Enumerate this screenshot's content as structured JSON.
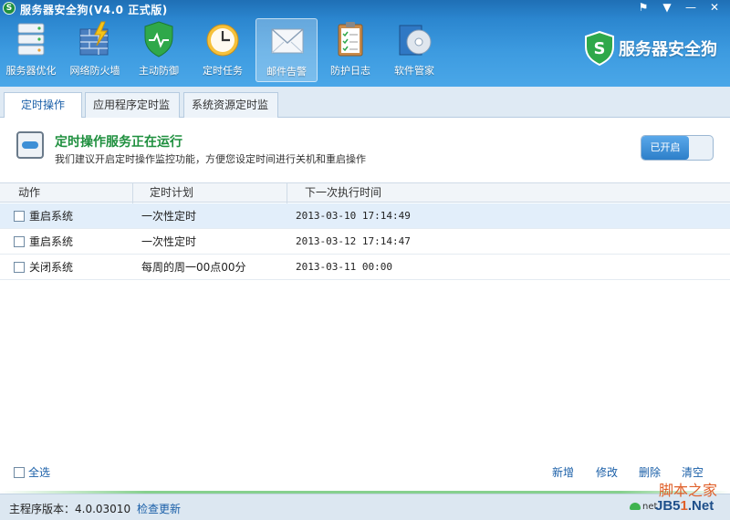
{
  "window": {
    "title": "服务器安全狗(V4.0 正式版)",
    "logo_letter": "S",
    "buttons": [
      "⚑",
      "▼",
      "—",
      "✕"
    ]
  },
  "toolbar": {
    "items": [
      {
        "label": "服务器优化",
        "icon": "server-rack-icon"
      },
      {
        "label": "网络防火墙",
        "icon": "firewall-bolt-icon"
      },
      {
        "label": "主动防御",
        "icon": "shield-icon"
      },
      {
        "label": "定时任务",
        "icon": "clock-icon"
      },
      {
        "label": "邮件告警",
        "icon": "mail-icon"
      },
      {
        "label": "防护日志",
        "icon": "clipboard-icon"
      },
      {
        "label": "软件管家",
        "icon": "disc-box-icon"
      }
    ],
    "active_index": 4
  },
  "brand": {
    "text": "服务器安全狗",
    "badge_letter": "S"
  },
  "tabs": [
    {
      "label": "定时操作",
      "active": true
    },
    {
      "label": "应用程序定时监控",
      "active": false
    },
    {
      "label": "系统资源定时监控",
      "active": false
    }
  ],
  "status": {
    "title": "定时操作服务正在运行",
    "description": "我们建议开启定时操作监控功能，方便您设定时间进行关机和重启操作",
    "toggle_label": "已开启"
  },
  "table": {
    "columns": [
      "动作",
      "定时计划",
      "下一次执行时间"
    ],
    "rows": [
      {
        "action": "重启系统",
        "plan": "一次性定时",
        "next": "2013-03-10 17:14:49",
        "selected": true
      },
      {
        "action": "重启系统",
        "plan": "一次性定时",
        "next": "2013-03-12 17:14:47",
        "selected": false
      },
      {
        "action": "关闭系统",
        "plan": "每周的周一00点00分",
        "next": "2013-03-11 00:00",
        "selected": false
      }
    ]
  },
  "footer": {
    "select_all": "全选",
    "actions": [
      "新增",
      "修改",
      "删除",
      "清空"
    ]
  },
  "statusbar": {
    "version": "主程序版本：4.0.03010",
    "check_update": "检查更新",
    "net_label": "net"
  },
  "watermark": {
    "cn": "脚本之家",
    "en_prefix": "JB5",
    "en_num": "1",
    "en_suffix": ".Net"
  },
  "colors": {
    "toolbar_blue": "#3d9be0",
    "status_green": "#1e8f3e",
    "link_blue": "#1a5fa8"
  }
}
